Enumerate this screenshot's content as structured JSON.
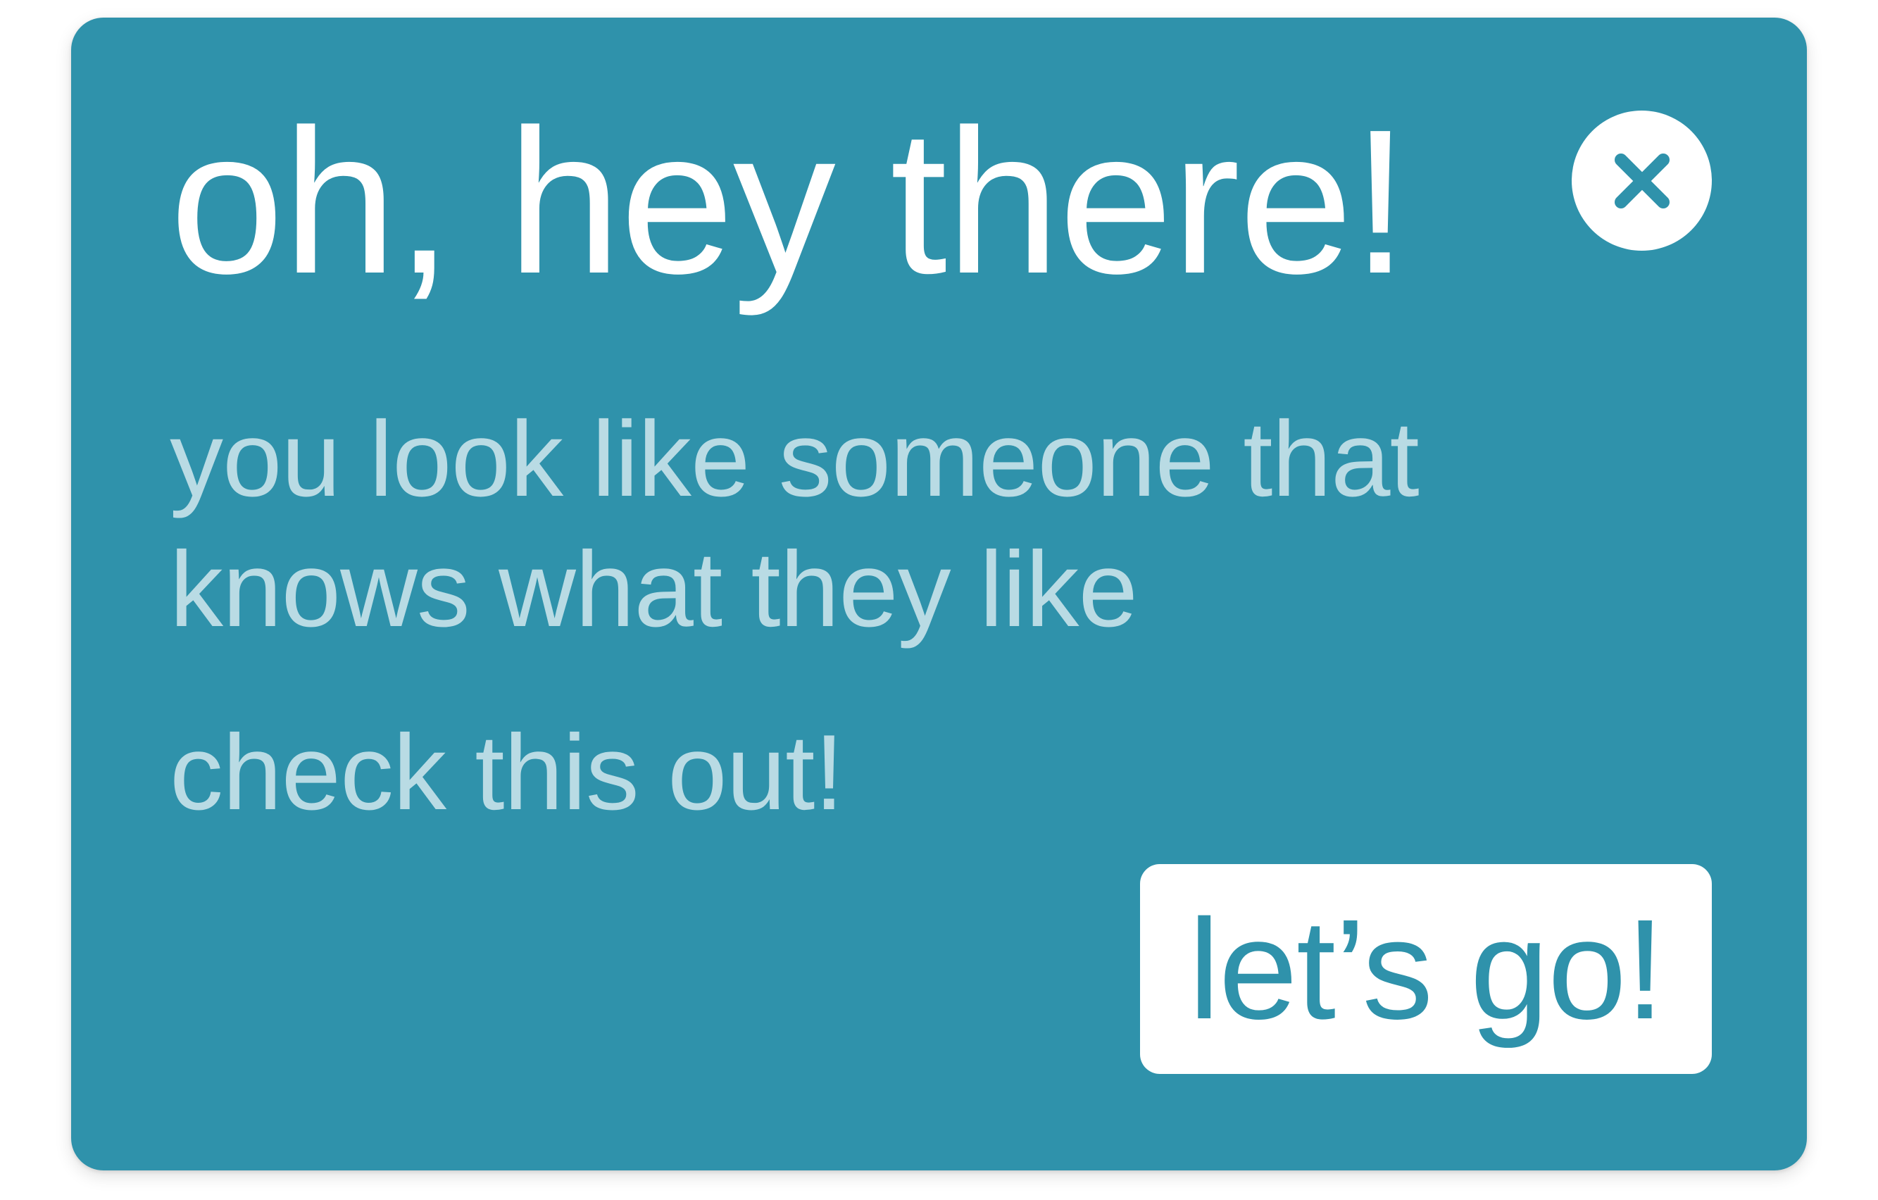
{
  "popup": {
    "title": "oh, hey there!",
    "message_line1": "you look like someone that",
    "message_line2": "knows what they like",
    "message_line3": "check this out!",
    "cta_label": "let’s go!",
    "close_icon": "close-x-icon"
  },
  "colors": {
    "card_background": "#2f92ab",
    "title_text": "#ffffff",
    "body_text": "#b9dbe4",
    "button_background": "#ffffff",
    "button_text": "#2f92ab"
  }
}
